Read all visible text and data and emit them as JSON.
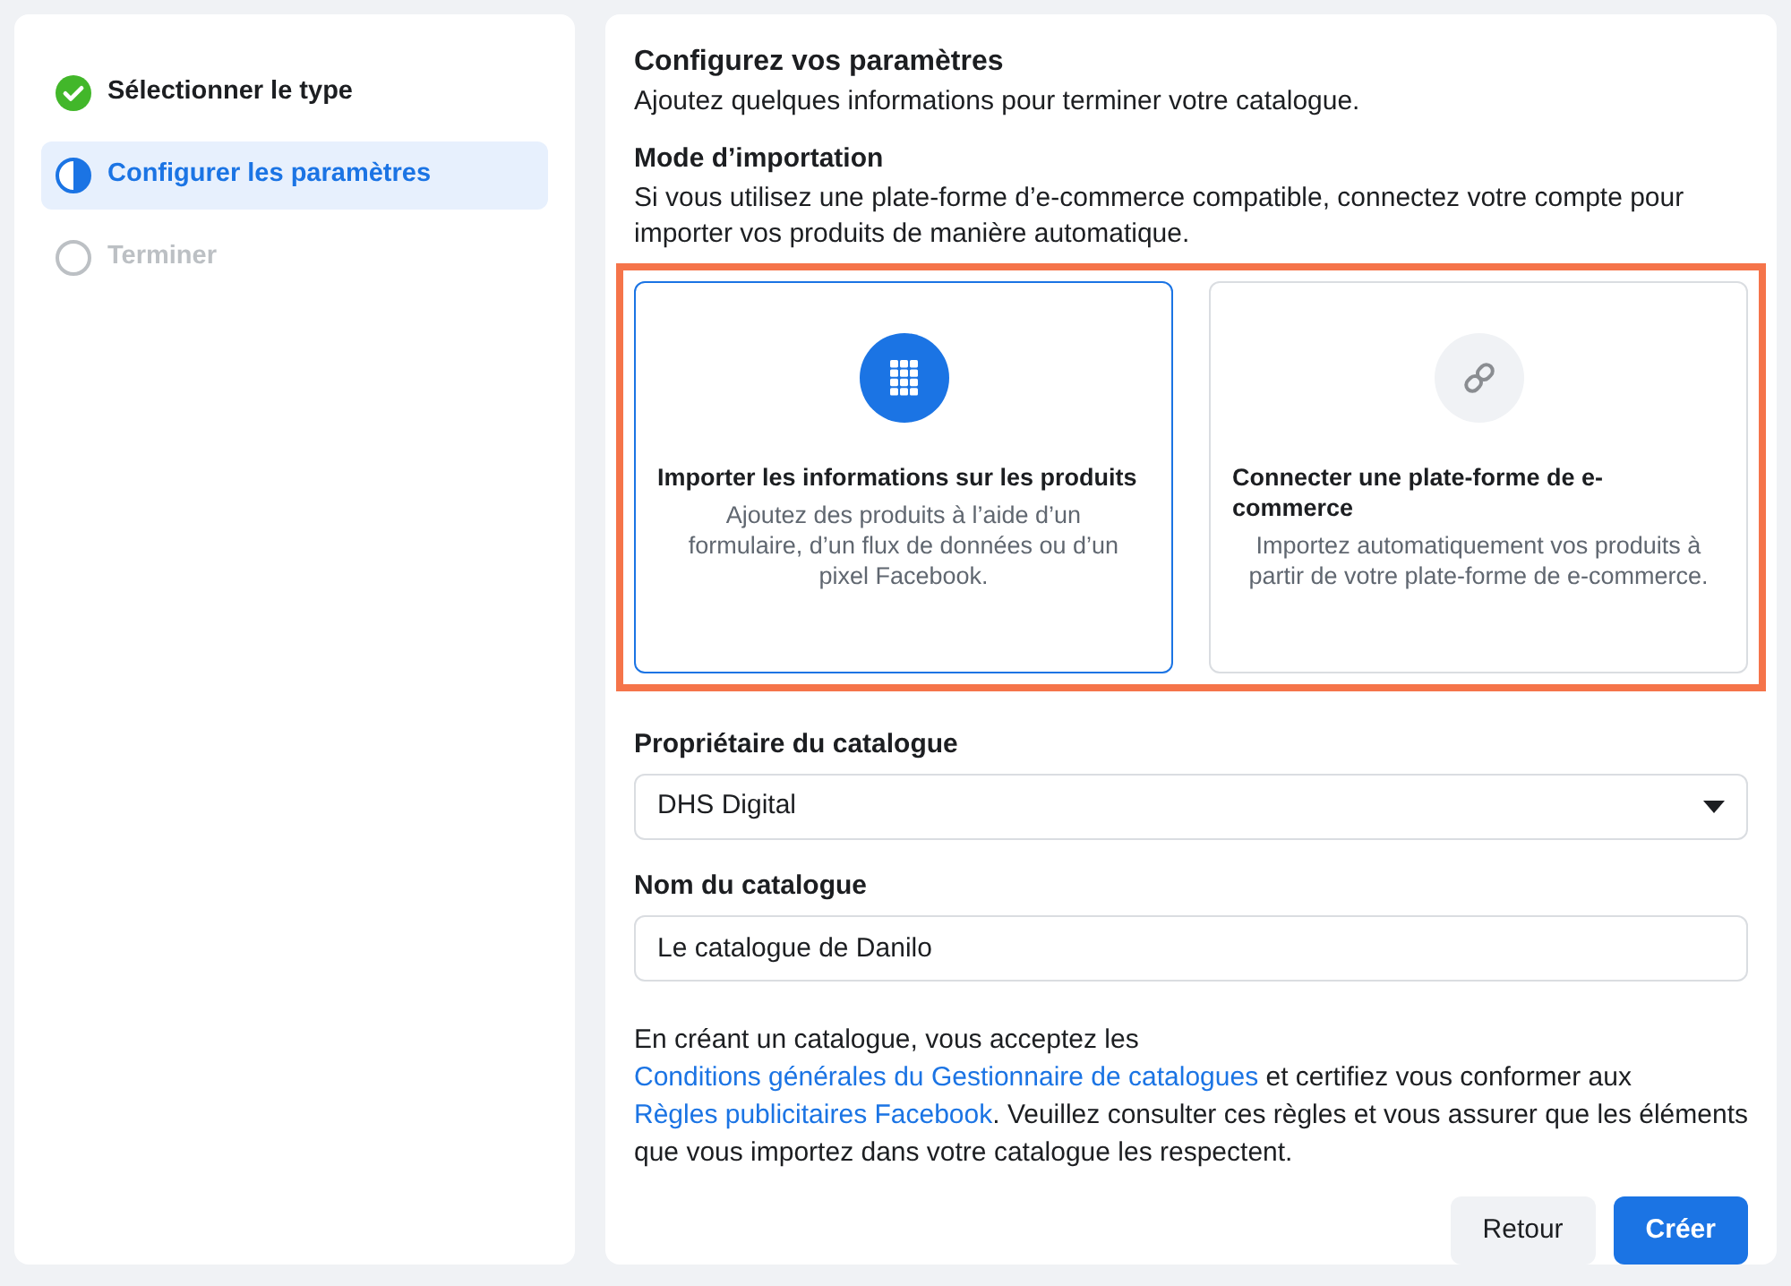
{
  "steps": [
    {
      "label": "Sélectionner le type",
      "kind": "done",
      "selected": false
    },
    {
      "label": "Configurer les paramètres",
      "kind": "current",
      "selected": true
    },
    {
      "label": "Terminer",
      "kind": "pending",
      "selected": false
    }
  ],
  "header": {
    "title": "Configurez vos paramètres",
    "subtitle": "Ajoutez quelques informations pour terminer votre catalogue."
  },
  "import_mode": {
    "title": "Mode d’importation",
    "description": "Si vous utilisez une plate-forme d’e-commerce compatible, connectez votre compte pour importer vos produits de manière automatique.",
    "highlighted": true,
    "options": [
      {
        "title": "Importer les informations sur les produits",
        "description": "Ajoutez des produits à l’aide d’un formulaire, d’un flux de données ou d’un pixel Facebook.",
        "selected": true
      },
      {
        "title": "Connecter une plate-forme de e-commerce",
        "description": "Importez automatiquement vos produits à partir de votre plate-forme de e-commerce.",
        "selected": false
      }
    ]
  },
  "owner": {
    "label": "Propriétaire du catalogue",
    "value": "DHS Digital"
  },
  "name": {
    "label": "Nom du catalogue",
    "value": "Le catalogue de Danilo"
  },
  "terms": [
    {
      "kind": "text",
      "text": "En créant un catalogue, vous acceptez les "
    },
    {
      "kind": "link",
      "text": "Conditions générales du Gestionnaire de catalogues"
    },
    {
      "kind": "text",
      "text": " et certifiez vous conformer aux "
    },
    {
      "kind": "link",
      "text": "Règles publicitaires Facebook"
    },
    {
      "kind": "text",
      "text": ". Veuillez consulter ces règles et vous assurer que les éléments que vous importez dans votre catalogue les respectent."
    }
  ],
  "buttons": [
    {
      "label": "Retour",
      "kind": "secondary"
    },
    {
      "label": "Créer",
      "kind": "primary"
    }
  ]
}
